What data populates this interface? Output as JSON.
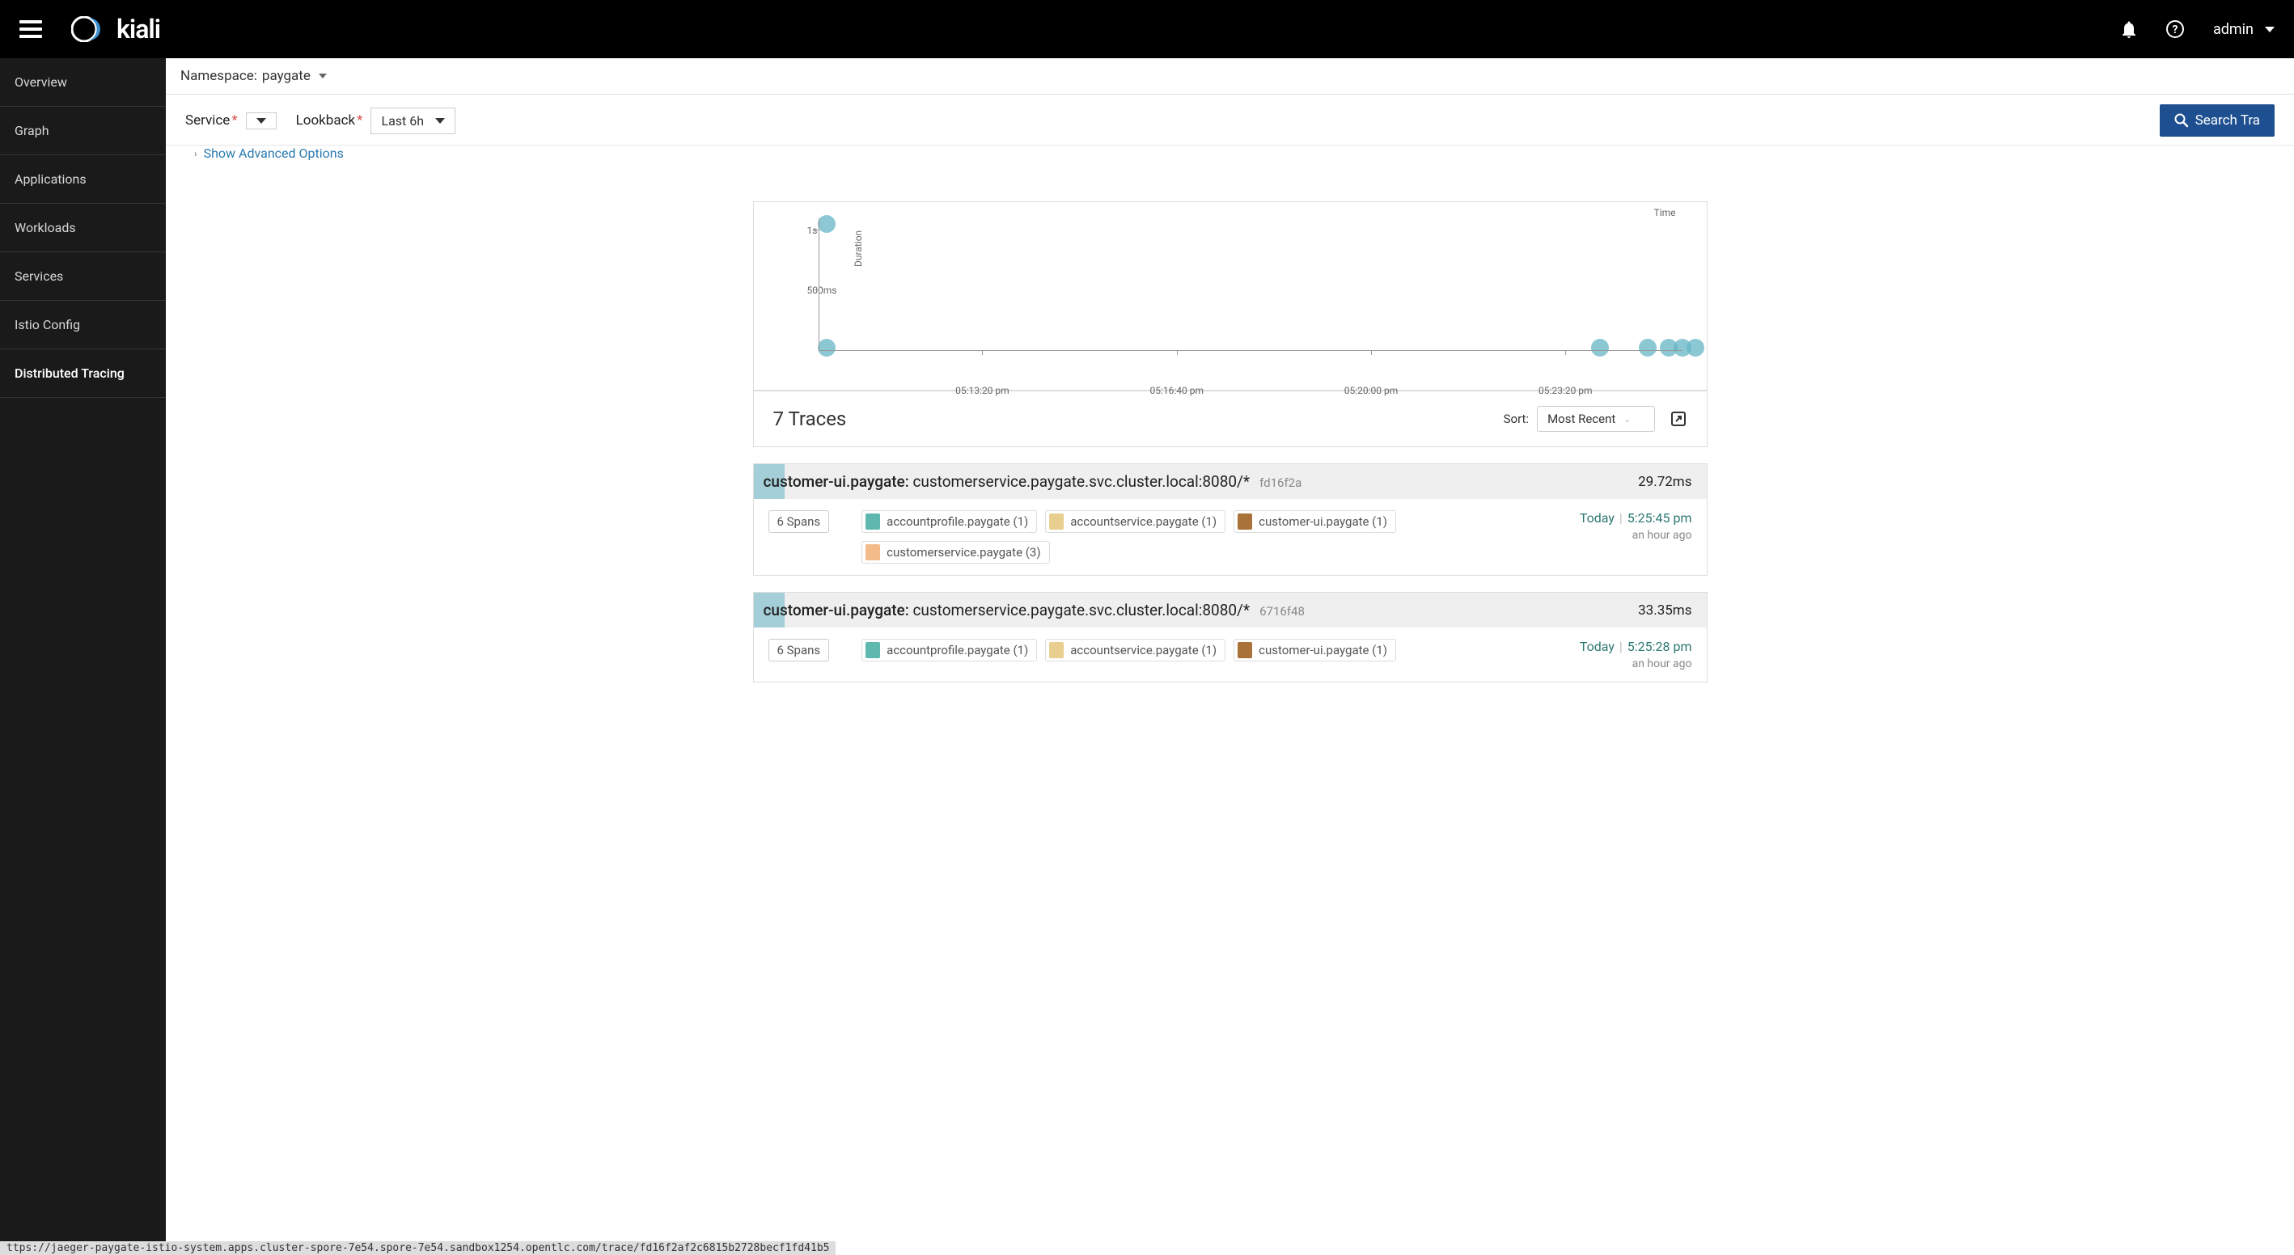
{
  "topbar": {
    "app_name": "kiali",
    "user": "admin"
  },
  "sidebar": {
    "items": [
      {
        "label": "Overview"
      },
      {
        "label": "Graph"
      },
      {
        "label": "Applications"
      },
      {
        "label": "Workloads"
      },
      {
        "label": "Services"
      },
      {
        "label": "Istio Config"
      },
      {
        "label": "Distributed Tracing"
      }
    ],
    "active_index": 6
  },
  "namespace": {
    "label": "Namespace:",
    "value": "paygate"
  },
  "controls": {
    "service_label": "Service",
    "lookback_label": "Lookback",
    "lookback_value": "Last 6h",
    "advanced_label": "Show Advanced Options",
    "search_button": "Search Tra"
  },
  "chart_data": {
    "type": "scatter",
    "ylabel": "Duration",
    "xlabel_right": "Time",
    "y_ticks": [
      {
        "label": "1s",
        "value": 1000
      },
      {
        "label": "500ms",
        "value": 500
      }
    ],
    "x_ticks": [
      "05:13:20 pm",
      "05:16:40 pm",
      "05:20:00 pm",
      "05:23:20 pm"
    ],
    "x_range_min": "05:11:00 pm",
    "x_range_max": "05:26:00 pm",
    "y_range_ms": [
      0,
      1100
    ],
    "points": [
      {
        "x_frac": 0.01,
        "y_ms": 1050
      },
      {
        "x_frac": 0.01,
        "y_ms": 30
      },
      {
        "x_frac": 0.905,
        "y_ms": 30
      },
      {
        "x_frac": 0.96,
        "y_ms": 30
      },
      {
        "x_frac": 0.985,
        "y_ms": 30
      },
      {
        "x_frac": 1.0,
        "y_ms": 30
      },
      {
        "x_frac": 1.015,
        "y_ms": 30
      }
    ]
  },
  "traces_header": {
    "count_text": "7 Traces",
    "sort_label": "Sort:",
    "sort_value": "Most Recent"
  },
  "traces": [
    {
      "title_service": "customer-ui.paygate:",
      "title_op": "customerservice.paygate.svc.cluster.local:8080/*",
      "trace_id": "fd16f2a",
      "duration": "29.72ms",
      "spans": "6 Spans",
      "tags": [
        {
          "color": "sw-teal",
          "label": "accountprofile.paygate (1)"
        },
        {
          "color": "sw-sand",
          "label": "accountservice.paygate (1)"
        },
        {
          "color": "sw-brown",
          "label": "customer-ui.paygate (1)"
        },
        {
          "color": "sw-peach",
          "label": "customerservice.paygate (3)"
        }
      ],
      "today": "Today",
      "time": "5:25:45 pm",
      "ago": "an hour ago"
    },
    {
      "title_service": "customer-ui.paygate:",
      "title_op": "customerservice.paygate.svc.cluster.local:8080/*",
      "trace_id": "6716f48",
      "duration": "33.35ms",
      "spans": "6 Spans",
      "tags": [
        {
          "color": "sw-teal",
          "label": "accountprofile.paygate (1)"
        },
        {
          "color": "sw-sand",
          "label": "accountservice.paygate (1)"
        },
        {
          "color": "sw-brown",
          "label": "customer-ui.paygate (1)"
        }
      ],
      "today": "Today",
      "time": "5:25:28 pm",
      "ago": "an hour ago"
    }
  ],
  "status_url": "ttps://jaeger-paygate-istio-system.apps.cluster-spore-7e54.spore-7e54.sandbox1254.opentlc.com/trace/fd16f2af2c6815b2728becf1fd41b5"
}
